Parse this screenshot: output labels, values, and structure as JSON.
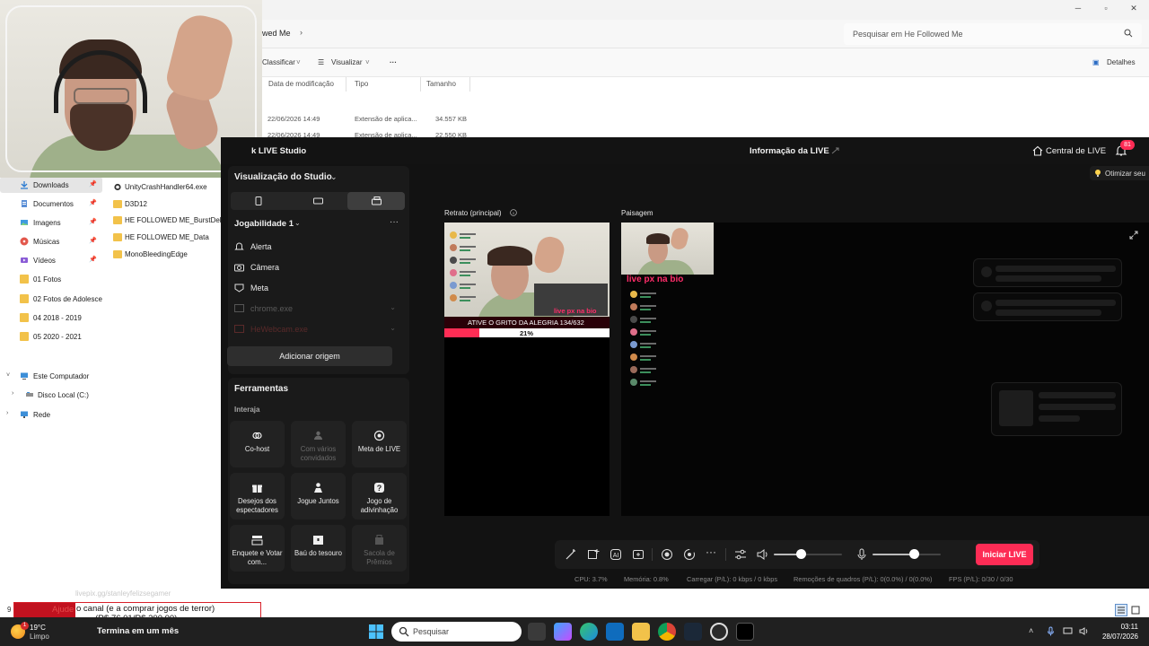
{
  "explorer": {
    "breadcrumb": "wed Me",
    "search_placeholder": "Pesquisar em He Followed Me",
    "toolbar": {
      "sort": "Classificar",
      "view": "Visualizar",
      "details": "Detalhes"
    },
    "columns": [
      "Data de modificação",
      "Tipo",
      "Tamanho"
    ],
    "files_top": [
      {
        "date": "22/06/2026 14:49",
        "type": "Extensão de aplica...",
        "size": "34.557 KB"
      },
      {
        "date": "22/06/2026 14:49",
        "type": "Extensão de aplica...",
        "size": "22.550 KB"
      }
    ],
    "nav": [
      {
        "label": "Downloads",
        "icon": "download-icon",
        "pinned": true,
        "active": true
      },
      {
        "label": "Documentos",
        "icon": "document-icon",
        "pinned": true
      },
      {
        "label": "Imagens",
        "icon": "image-icon",
        "pinned": true
      },
      {
        "label": "Músicas",
        "icon": "music-icon",
        "pinned": true
      },
      {
        "label": "Vídeos",
        "icon": "video-icon",
        "pinned": true
      },
      {
        "label": "01 Fotos",
        "icon": "folder-icon"
      },
      {
        "label": "02 Fotos de Adolesce",
        "icon": "folder-icon"
      },
      {
        "label": "04 2018 - 2019",
        "icon": "folder-icon"
      },
      {
        "label": "05 2020 - 2021",
        "icon": "folder-icon"
      },
      {
        "label": "Este Computador",
        "icon": "computer-icon"
      },
      {
        "label": "Disco Local (C:)",
        "icon": "drive-icon"
      },
      {
        "label": "Rede",
        "icon": "network-icon"
      }
    ],
    "file_list": [
      {
        "label": "UnityCrashHandler64.exe",
        "icon": "app-icon"
      },
      {
        "label": "D3D12",
        "icon": "folder-icon"
      },
      {
        "label": "HE FOLLOWED ME_BurstDebu",
        "icon": "folder-icon"
      },
      {
        "label": "HE FOLLOWED ME_Data",
        "icon": "folder-icon"
      },
      {
        "label": "MonoBleedingEdge",
        "icon": "folder-icon"
      }
    ],
    "status_count": "9"
  },
  "studio": {
    "app_name": "k LIVE Studio",
    "info_title": "Informação da LIVE",
    "central": "Central de LIVE",
    "notif_count": "81",
    "optimize": "Otimizar seu",
    "studio_view": "Visualização do Studio",
    "scene": "Jogabilidade 1",
    "sources": [
      {
        "label": "Alerta",
        "icon": "bell-icon",
        "dim": false
      },
      {
        "label": "Câmera",
        "icon": "camera-icon",
        "dim": false
      },
      {
        "label": "Meta",
        "icon": "goal-icon",
        "dim": false
      },
      {
        "label": "chrome.exe",
        "icon": "window-icon",
        "dim": true
      },
      {
        "label": "HeWebcam.exe",
        "icon": "window-icon",
        "dim": true
      }
    ],
    "add_origin": "Adicionar origem",
    "tools_title": "Ferramentas",
    "tools_sub": "Interaja",
    "tools": [
      {
        "label": "Co-host",
        "icon": "cohost-icon",
        "disabled": false
      },
      {
        "label": "Com vários convidados",
        "icon": "multi-guest-icon",
        "disabled": true
      },
      {
        "label": "Meta de LIVE",
        "icon": "live-goal-icon",
        "disabled": false
      },
      {
        "label": "Desejos dos espectadores",
        "icon": "gift-icon",
        "disabled": false
      },
      {
        "label": "Jogue Juntos",
        "icon": "play-together-icon",
        "disabled": false
      },
      {
        "label": "Jogo de adivinhação",
        "icon": "question-icon",
        "disabled": false
      },
      {
        "label": "Enquete e Votar com...",
        "icon": "poll-icon",
        "disabled": false
      },
      {
        "label": "Baú do tesouro",
        "icon": "treasure-icon",
        "disabled": false
      },
      {
        "label": "Sacola de Prêmios",
        "icon": "prize-bag-icon",
        "disabled": true
      }
    ],
    "portrait_label": "Retrato (principal)",
    "landscape_label": "Paisagem",
    "live_px": "live px na bio",
    "goal_text": "ATIVE O GRITO DA ALEGRIA 134/632",
    "goal_percent": "21%",
    "goal_fraction": 0.21,
    "start_live": "Iniciar LIVE",
    "volume_level": 0.4,
    "mic_level": 0.6,
    "stats": {
      "cpu": "CPU:  3.7%",
      "memory": "Memória:  0.8%",
      "upload": "Carregar (P/L):  0 kbps / 0 kbps",
      "dropped": "Remoções de quadros (P/L):  0(0.0%) / 0(0.0%)",
      "fps": "FPS (P/L):  0/30 / 0/30"
    }
  },
  "donation": {
    "ajude": "Ajude",
    "text": "o canal (e a comprar jogos de terror)",
    "amount": "(R$ 76.01/R$ 300.00)",
    "url": "livepix.gg/stanleyfelizsegamer"
  },
  "taskbar": {
    "temp": "19°C",
    "weather": "Limpo",
    "weather_badge": "1",
    "promo": "Termina em um mês",
    "search": "Pesquisar",
    "time": "03:11",
    "date": "28/07/2026"
  },
  "colors": {
    "tiktok_red": "#fe2c55",
    "studio_bg": "#121212",
    "folder": "#f2c24a"
  }
}
